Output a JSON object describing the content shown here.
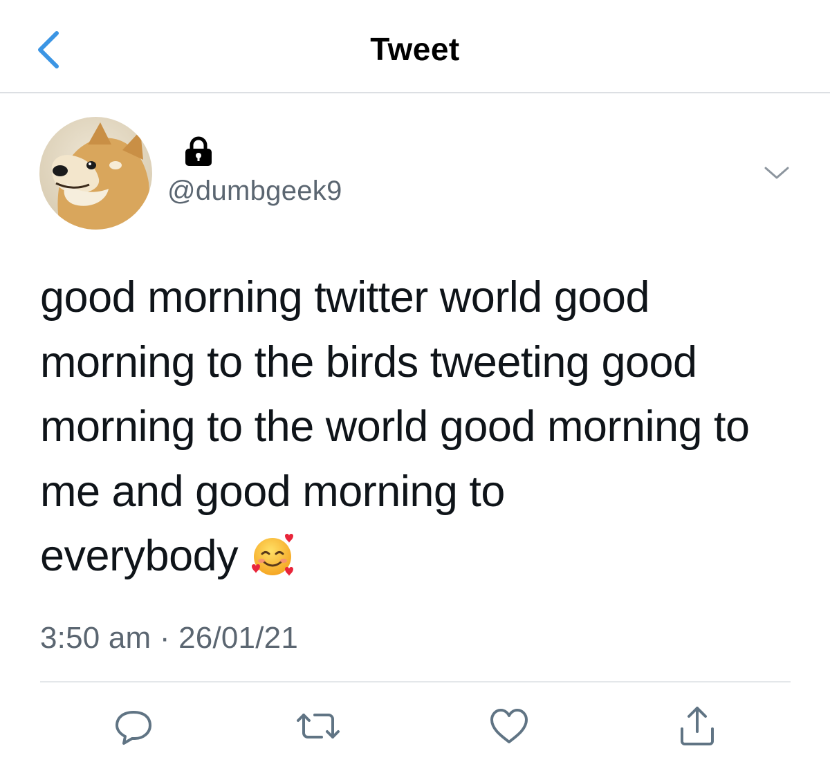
{
  "header": {
    "title": "Tweet",
    "back_icon": "chevron-left-icon",
    "accent_color": "#3b95e4"
  },
  "author": {
    "handle": "@dumbgeek9",
    "protected_icon": "lock-icon",
    "avatar": "shiba-inu-avatar"
  },
  "tweet": {
    "lines": [
      "good morning twitter world good",
      "morning to the birds tweeting good",
      "morning to the world good morning to",
      "me and good morning to",
      "everybody"
    ],
    "emoji": "smiling-face-with-hearts-emoji"
  },
  "meta": {
    "time": "3:50 am",
    "separator": "·",
    "date": "26/01/21"
  },
  "actions": [
    "reply-icon",
    "retweet-icon",
    "like-icon",
    "share-icon"
  ],
  "colors": {
    "text": "#0f1419",
    "secondary": "#5b6671",
    "icon": "#607484"
  }
}
